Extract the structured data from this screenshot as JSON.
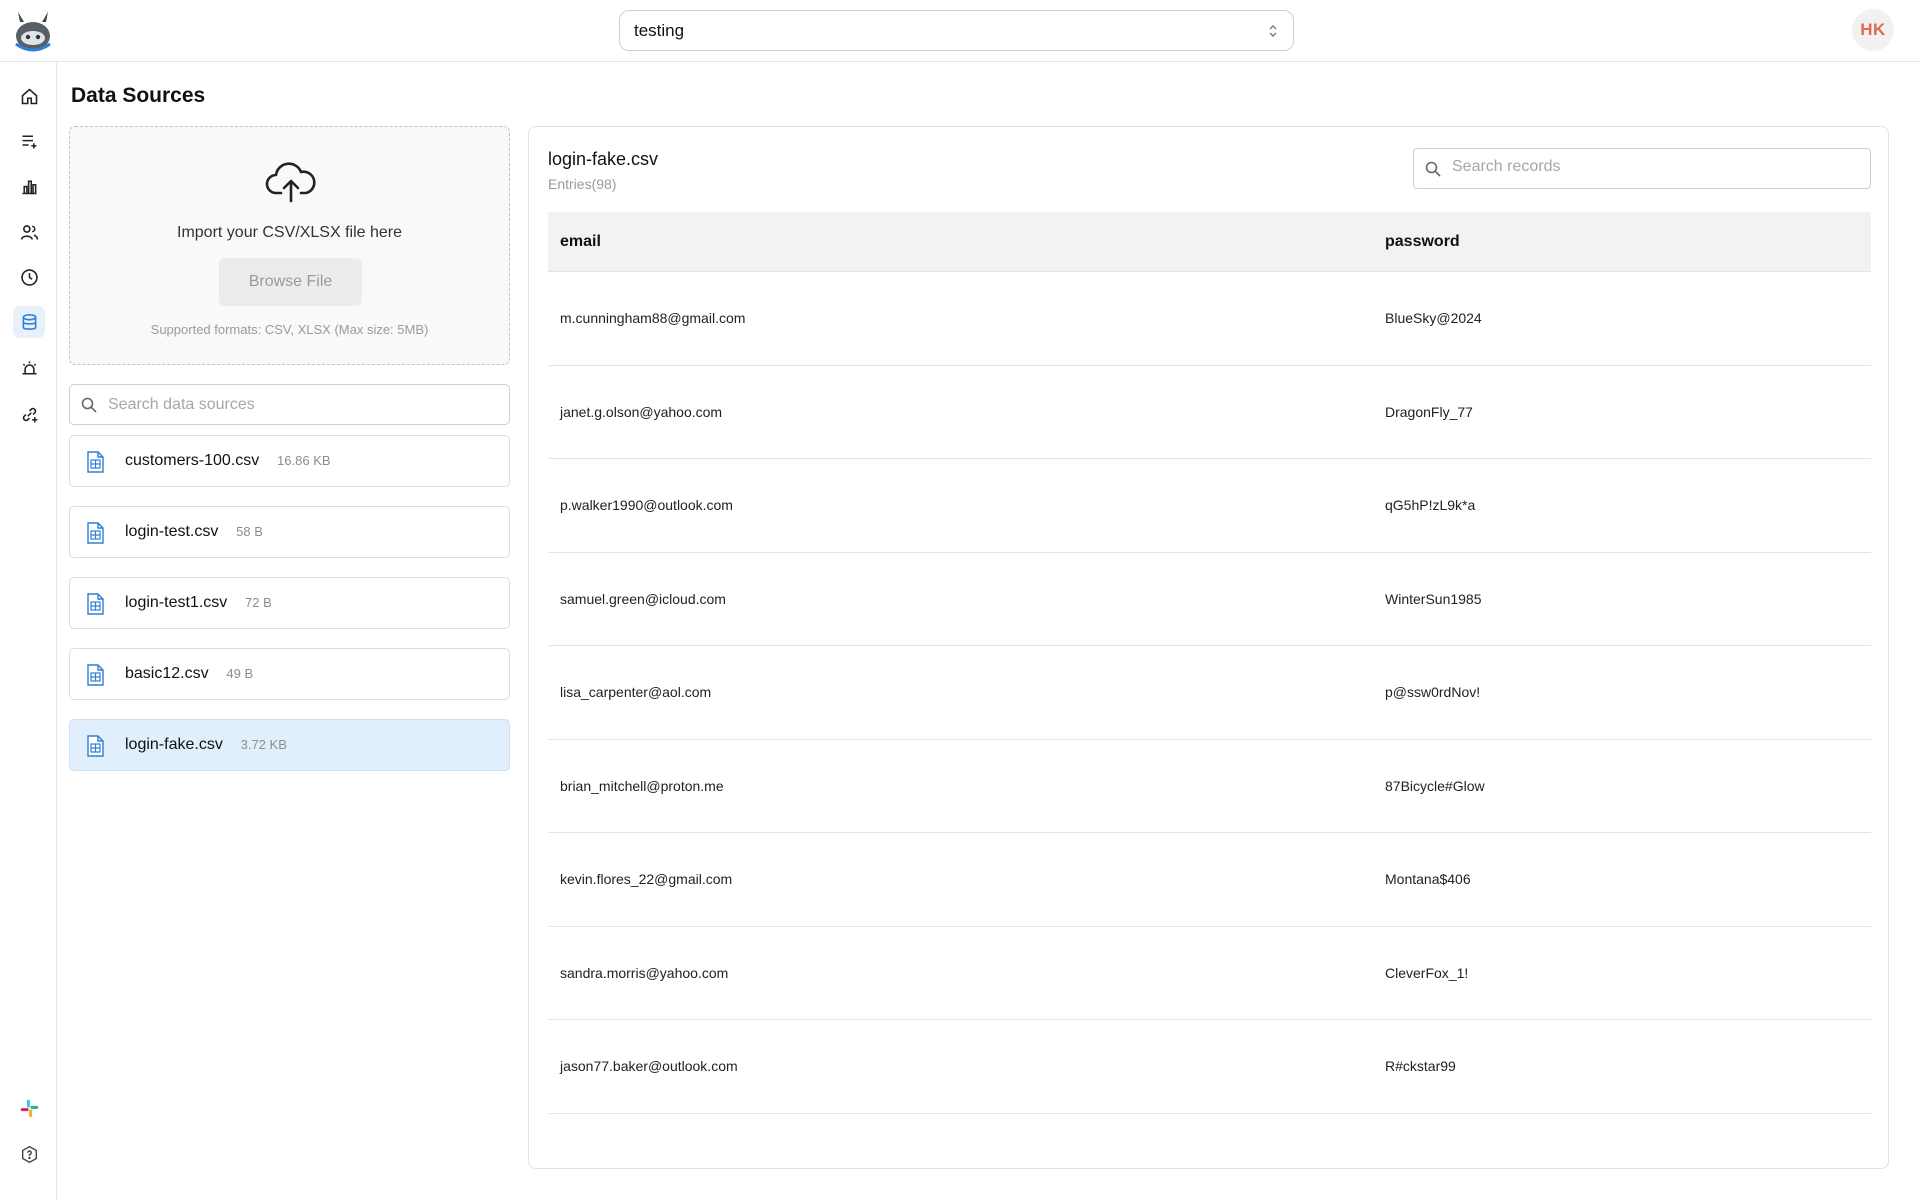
{
  "header": {
    "project": "testing",
    "avatar_initials": "HK"
  },
  "rail": {
    "items": [
      "home-icon",
      "list-add-icon",
      "bar-chart-icon",
      "users-icon",
      "clock-icon",
      "database-icon",
      "alarm-icon",
      "link-plus-icon"
    ],
    "active": "database-icon",
    "bottom": [
      "slack-icon",
      "help-icon"
    ]
  },
  "page": {
    "title": "Data Sources"
  },
  "upload": {
    "label": "Import your CSV/XLSX file here",
    "browse_label": "Browse File",
    "formats": "Supported formats: CSV, XLSX (Max size: 5MB)"
  },
  "sources": {
    "search_placeholder": "Search data sources",
    "items": [
      {
        "name": "customers-100.csv",
        "size": "16.86 KB"
      },
      {
        "name": "login-test.csv",
        "size": "58 B"
      },
      {
        "name": "login-test1.csv",
        "size": "72 B"
      },
      {
        "name": "basic12.csv",
        "size": "49 B"
      },
      {
        "name": "login-fake.csv",
        "size": "3.72 KB"
      }
    ],
    "selected_index": 4
  },
  "detail": {
    "file_name": "login-fake.csv",
    "entries": "Entries(98)",
    "search_placeholder": "Search records",
    "columns": [
      "email",
      "password"
    ],
    "rows": [
      [
        "m.cunningham88@gmail.com",
        "BlueSky@2024"
      ],
      [
        "janet.g.olson@yahoo.com",
        "DragonFly_77"
      ],
      [
        "p.walker1990@outlook.com",
        "qG5hP!zL9k*a"
      ],
      [
        "samuel.green@icloud.com",
        "WinterSun1985"
      ],
      [
        "lisa_carpenter@aol.com",
        "p@ssw0rdNov!"
      ],
      [
        "brian_mitchell@proton.me",
        "87Bicycle#Glow"
      ],
      [
        "kevin.flores_22@gmail.com",
        "Montana$406"
      ],
      [
        "sandra.morris@yahoo.com",
        "CleverFox_1!"
      ],
      [
        "jason77.baker@outlook.com",
        "R#ckstar99"
      ]
    ]
  },
  "colors": {
    "accent": "#2f7fd6",
    "avatar_text": "#e2674f",
    "selected_bg": "#e1eefb"
  }
}
